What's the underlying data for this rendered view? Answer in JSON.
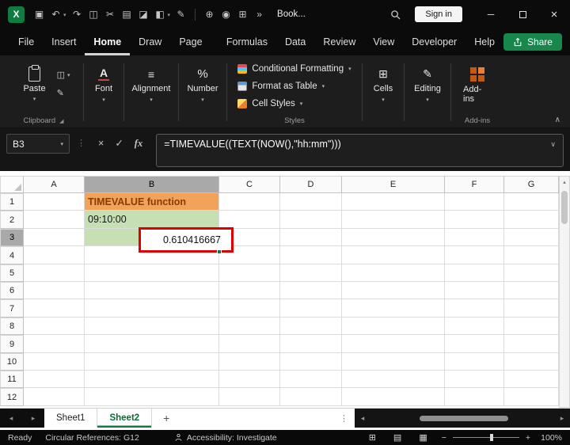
{
  "titlebar": {
    "app_logo_text": "X",
    "document_name": "Book...",
    "sign_in_label": "Sign in",
    "quick_access": [
      {
        "name": "save-icon",
        "glyph": "▣"
      },
      {
        "name": "undo-icon",
        "glyph": "↶",
        "dropdown": true
      },
      {
        "name": "redo-icon",
        "glyph": "↷"
      },
      {
        "name": "copy-icon",
        "glyph": "◫"
      },
      {
        "name": "cut-icon",
        "glyph": "✂"
      },
      {
        "name": "clipboard-icon",
        "glyph": "▤"
      },
      {
        "name": "eraser-icon",
        "glyph": "◪"
      },
      {
        "name": "fill-color-icon",
        "glyph": "◧",
        "dropdown": true
      },
      {
        "name": "format-painter-icon",
        "glyph": "✎"
      },
      {
        "divider": true
      },
      {
        "name": "pin-icon",
        "glyph": "⊕"
      },
      {
        "name": "camera-icon",
        "glyph": "◉"
      },
      {
        "name": "insert-table-icon",
        "glyph": "⊞"
      },
      {
        "name": "overflow-icon",
        "glyph": "»"
      }
    ],
    "window_controls": {
      "minimize": "─",
      "close": "×"
    }
  },
  "ribbon_tabs": [
    {
      "label": "File"
    },
    {
      "label": "Insert"
    },
    {
      "label": "Home",
      "active": true
    },
    {
      "label": "Draw"
    },
    {
      "label": "Page Layout"
    },
    {
      "label": "Formulas"
    },
    {
      "label": "Data"
    },
    {
      "label": "Review"
    },
    {
      "label": "View"
    },
    {
      "label": "Developer"
    },
    {
      "label": "Help"
    }
  ],
  "share_button": {
    "label": "Share"
  },
  "ribbon": {
    "clipboard": {
      "group_label": "Clipboard",
      "paste_label": "Paste"
    },
    "font": {
      "label": "Font"
    },
    "alignment": {
      "label": "Alignment"
    },
    "number": {
      "label": "Number"
    },
    "styles": {
      "group_label": "Styles",
      "items": [
        "Conditional Formatting",
        "Format as Table",
        "Cell Styles"
      ]
    },
    "cells": {
      "label": "Cells"
    },
    "editing": {
      "label": "Editing"
    },
    "addins": {
      "label": "Add-ins",
      "group_label": "Add-ins"
    }
  },
  "formula_bar": {
    "name_box": "B3",
    "formula": "=TIMEVALUE((TEXT(NOW(),\"hh:mm\")))"
  },
  "grid": {
    "columns": [
      "A",
      "B",
      "C",
      "D",
      "E",
      "F",
      "G"
    ],
    "rows": [
      "1",
      "2",
      "3",
      "4",
      "5",
      "6",
      "7",
      "8",
      "9",
      "10",
      "11",
      "12"
    ],
    "selected_column": "B",
    "selected_row": "3",
    "cells": [
      {
        "ref": "B1",
        "text": "TIMEVALUE function",
        "bg": "#F2A359",
        "color": "#8A3B00",
        "bold": true
      },
      {
        "ref": "B2",
        "text": "09:10:00",
        "bg": "#C6E0B4",
        "color": "#141414"
      },
      {
        "ref": "B3",
        "text": "",
        "bg": "#C6E0B4",
        "color": "#141414"
      }
    ],
    "annotation": {
      "text": "0.610416667"
    }
  },
  "sheet_bar": {
    "tabs": [
      {
        "label": "Sheet1"
      },
      {
        "label": "Sheet2",
        "active": true
      }
    ],
    "add_label": "+"
  },
  "status_bar": {
    "ready": "Ready",
    "circular_refs": "Circular References: G12",
    "accessibility": "Accessibility: Investigate",
    "view_icons": [
      {
        "name": "normal-view-icon",
        "glyph": "⊞"
      },
      {
        "name": "page-layout-view-icon",
        "glyph": "▤"
      },
      {
        "name": "page-break-view-icon",
        "glyph": "▦"
      }
    ],
    "zoom": "100%"
  },
  "icons": {
    "chevron_down": "▾",
    "collapse_ribbon": "∧",
    "formula_chevron": "∨",
    "dots": "⋮",
    "cancel": "×",
    "enter": "✓",
    "fx": "fx",
    "scroll_up": "▴",
    "scroll_left": "◂",
    "scroll_right": "▸",
    "minus": "−",
    "plus": "+",
    "copy": "◫",
    "format_painter": "✎",
    "font": "A",
    "alignment": "≡",
    "number": "%",
    "cells": "⊞",
    "editing": "✎"
  },
  "colors": {
    "accent_green": "#107C41",
    "annotation_red": "#E00000",
    "cell_orange": "#F2A359",
    "cell_green": "#C6E0B4"
  }
}
